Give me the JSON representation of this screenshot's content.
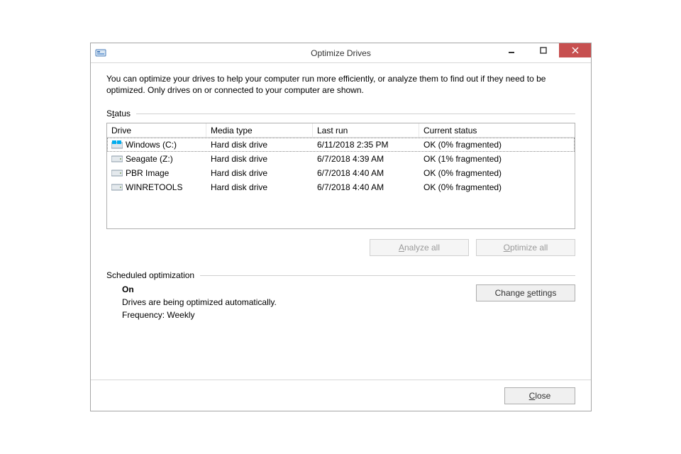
{
  "window": {
    "title": "Optimize Drives"
  },
  "intro": "You can optimize your drives to help your computer run more efficiently, or analyze them to find out if they need to be optimized. Only drives on or connected to your computer are shown.",
  "status_label_pre": "S",
  "status_label_u": "t",
  "status_label_post": "atus",
  "columns": {
    "drive": "Drive",
    "media": "Media type",
    "last": "Last run",
    "status": "Current status"
  },
  "drives": [
    {
      "name": "Windows (C:)",
      "media": "Hard disk drive",
      "last": "6/11/2018 2:35 PM",
      "status": "OK (0% fragmented)",
      "icon": "win",
      "selected": true
    },
    {
      "name": "Seagate (Z:)",
      "media": "Hard disk drive",
      "last": "6/7/2018 4:39 AM",
      "status": "OK (1% fragmented)",
      "icon": "hdd",
      "selected": false
    },
    {
      "name": "PBR Image",
      "media": "Hard disk drive",
      "last": "6/7/2018 4:40 AM",
      "status": "OK (0% fragmented)",
      "icon": "hdd",
      "selected": false
    },
    {
      "name": "WINRETOOLS",
      "media": "Hard disk drive",
      "last": "6/7/2018 4:40 AM",
      "status": "OK (0% fragmented)",
      "icon": "hdd",
      "selected": false
    }
  ],
  "buttons": {
    "analyze_u": "A",
    "analyze_rest": "nalyze all",
    "optimize_u": "O",
    "optimize_rest": "ptimize all",
    "change_pre": "Change ",
    "change_u": "s",
    "change_post": "ettings",
    "close_u": "C",
    "close_rest": "lose"
  },
  "scheduled": {
    "label": "Scheduled optimization",
    "on": "On",
    "desc": "Drives are being optimized automatically.",
    "freq": "Frequency: Weekly"
  }
}
